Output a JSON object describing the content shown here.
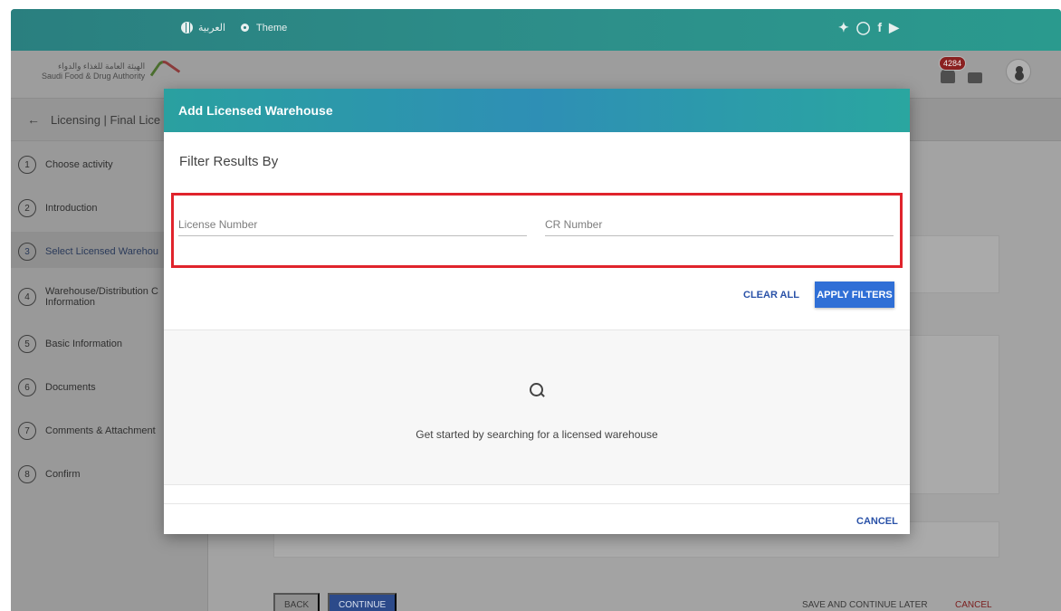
{
  "topbar": {
    "lang_label": "العربية",
    "theme_label": "Theme",
    "socials": [
      "twitter",
      "instagram",
      "facebook",
      "youtube"
    ]
  },
  "header": {
    "logo_arabic": "الهيئة العامة للغذاء والدواء",
    "logo_english": "Saudi Food & Drug Authority",
    "notification_count": "4284"
  },
  "breadcrumb": {
    "text": "Licensing | Final Lice"
  },
  "steps": [
    {
      "num": "1",
      "label": "Choose activity"
    },
    {
      "num": "2",
      "label": "Introduction"
    },
    {
      "num": "3",
      "label": "Select Licensed Warehou"
    },
    {
      "num": "4",
      "label": "Warehouse/Distribution C",
      "label2": "Information"
    },
    {
      "num": "5",
      "label": "Basic Information"
    },
    {
      "num": "6",
      "label": "Documents"
    },
    {
      "num": "7",
      "label": "Comments & Attachment"
    },
    {
      "num": "8",
      "label": "Confirm"
    }
  ],
  "footer": {
    "back_label": "BACK",
    "continue_label": "CONTINUE",
    "save_later_label": "SAVE AND CONTINUE LATER",
    "cancel_label": "CANCEL"
  },
  "modal": {
    "title": "Add Licensed Warehouse",
    "filter_title": "Filter Results By",
    "license_placeholder": "License Number",
    "cr_placeholder": "CR Number",
    "clear_all_label": "CLEAR ALL",
    "apply_label": "APPLY FILTERS",
    "empty_message": "Get started by searching for a licensed warehouse",
    "cancel_label": "CANCEL"
  },
  "colors": {
    "accent": "#2f6fd6",
    "header_teal": "#2aa0a0",
    "highlight": "#e0242c"
  }
}
